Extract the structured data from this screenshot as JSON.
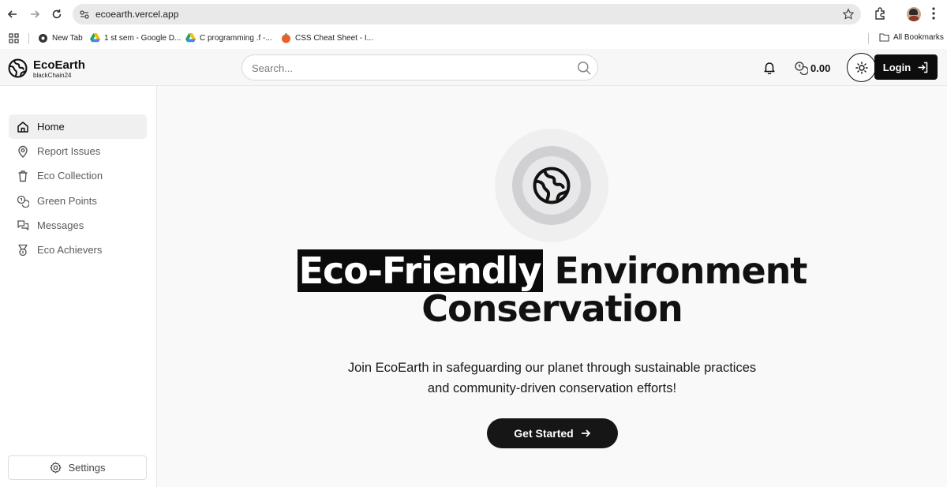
{
  "browser": {
    "url": "ecoearth.vercel.app",
    "bookmarks": [
      "New Tab",
      "1 st sem - Google D...",
      "C programming .f -...",
      "CSS Cheat Sheet - I..."
    ],
    "all_bookmarks": "All Bookmarks"
  },
  "header": {
    "brand": "EcoEarth",
    "brand_sub": "blackChain24",
    "search_placeholder": "Search...",
    "balance": "0.00",
    "login_label": "Login"
  },
  "sidebar": {
    "items": [
      {
        "label": "Home",
        "icon": "home-icon",
        "active": true
      },
      {
        "label": "Report Issues",
        "icon": "map-pin-icon"
      },
      {
        "label": "Eco Collection",
        "icon": "trash-icon"
      },
      {
        "label": "Green Points",
        "icon": "coins-icon"
      },
      {
        "label": "Messages",
        "icon": "messages-icon"
      },
      {
        "label": "Eco Achievers",
        "icon": "medal-icon"
      }
    ],
    "settings_label": "Settings"
  },
  "hero": {
    "title_highlight": "Eco-Friendly",
    "title_rest": " Environment",
    "title_line2": "Conservation",
    "subtitle": "Join EcoEarth in safeguarding our planet through sustainable practices and community-driven conservation efforts!",
    "cta_label": "Get Started"
  }
}
